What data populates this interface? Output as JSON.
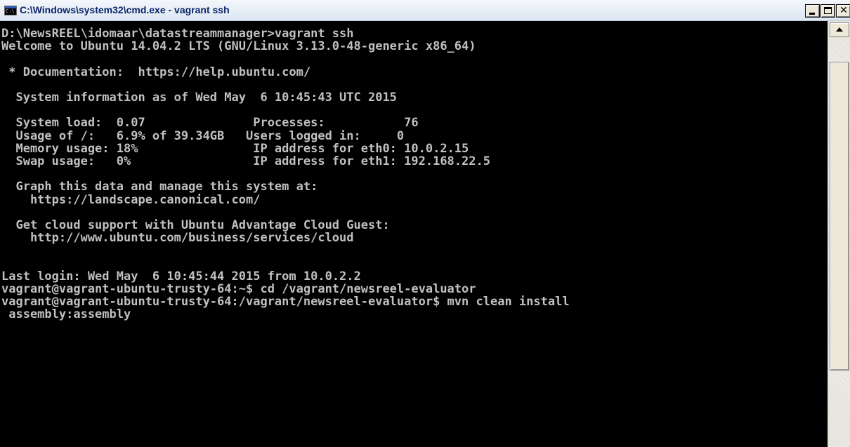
{
  "window": {
    "title": "C:\\Windows\\system32\\cmd.exe - vagrant  ssh",
    "icon_label": "C:\\",
    "buttons": {
      "minimize": "minimize-icon",
      "maximize": "maximize-icon",
      "close": "close-icon",
      "close_glyph": "✕"
    }
  },
  "console": {
    "lines": [
      "D:\\NewsREEL\\idomaar\\datastreammanager>vagrant ssh",
      "Welcome to Ubuntu 14.04.2 LTS (GNU/Linux 3.13.0-48-generic x86_64)",
      "",
      " * Documentation:  https://help.ubuntu.com/",
      "",
      "  System information as of Wed May  6 10:45:43 UTC 2015",
      "",
      "  System load:  0.07               Processes:           76",
      "  Usage of /:   6.9% of 39.34GB   Users logged in:     0",
      "  Memory usage: 18%                IP address for eth0: 10.0.2.15",
      "  Swap usage:   0%                 IP address for eth1: 192.168.22.5",
      "",
      "  Graph this data and manage this system at:",
      "    https://landscape.canonical.com/",
      "",
      "  Get cloud support with Ubuntu Advantage Cloud Guest:",
      "    http://www.ubuntu.com/business/services/cloud",
      "",
      "",
      "Last login: Wed May  6 10:45:44 2015 from 10.0.2.2",
      "vagrant@vagrant-ubuntu-trusty-64:~$ cd /vagrant/newsreel-evaluator",
      "vagrant@vagrant-ubuntu-trusty-64:/vagrant/newsreel-evaluator$ mvn clean install",
      " assembly:assembly"
    ]
  },
  "colors": {
    "console_background": "#000000",
    "console_text": "#c0c0c0",
    "title_text": "#0a246a"
  }
}
